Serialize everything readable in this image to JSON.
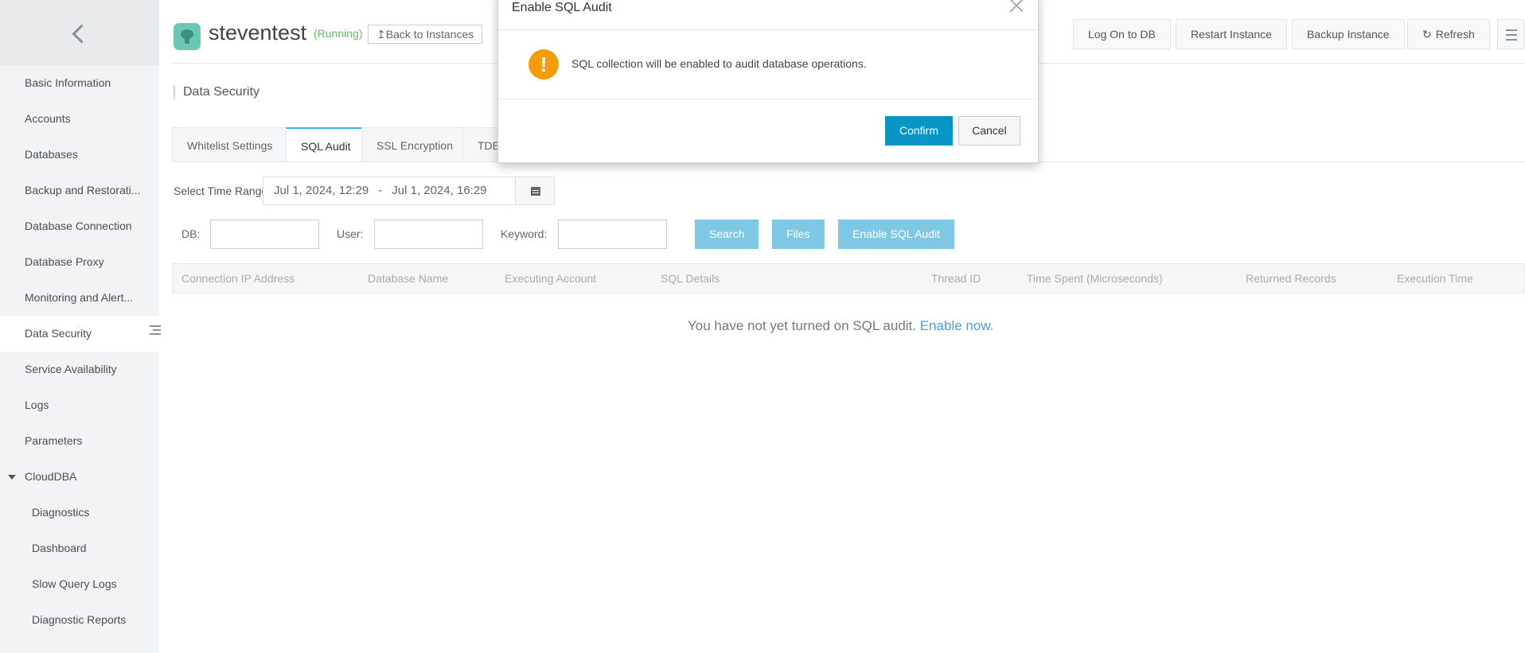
{
  "sidebar": {
    "items": [
      {
        "label": "Basic Information"
      },
      {
        "label": "Accounts"
      },
      {
        "label": "Databases"
      },
      {
        "label": "Backup and Restorati..."
      },
      {
        "label": "Database Connection"
      },
      {
        "label": "Database Proxy"
      },
      {
        "label": "Monitoring and Alert..."
      },
      {
        "label": "Data Security",
        "active": true
      },
      {
        "label": "Service Availability"
      },
      {
        "label": "Logs"
      },
      {
        "label": "Parameters"
      },
      {
        "label": "CloudDBA",
        "expanded": true
      },
      {
        "label": "Diagnostics"
      },
      {
        "label": "Dashboard"
      },
      {
        "label": "Slow Query Logs"
      },
      {
        "label": "Diagnostic Reports"
      }
    ]
  },
  "header": {
    "instance_name": "steventest",
    "status": "(Running)",
    "back_label": "Back to Instances",
    "buttons": {
      "log_on": "Log On to DB",
      "restart": "Restart Instance",
      "backup": "Backup Instance",
      "refresh": "Refresh"
    }
  },
  "section_title": "Data Security",
  "tabs": [
    {
      "label": "Whitelist Settings"
    },
    {
      "label": "SQL Audit",
      "active": true
    },
    {
      "label": "SSL Encryption"
    },
    {
      "label": "TDE"
    }
  ],
  "time_range": {
    "label": "Select Time Range",
    "start": "Jul 1, 2024, 12:29",
    "separator": "-",
    "end": "Jul 1, 2024, 16:29"
  },
  "filters": {
    "db_label": "DB:",
    "db_value": "",
    "user_label": "User:",
    "user_value": "",
    "keyword_label": "Keyword:",
    "keyword_value": "",
    "search_label": "Search",
    "files_label": "Files",
    "enable_label": "Enable SQL Audit"
  },
  "table": {
    "columns": [
      "Connection IP Address",
      "Database Name",
      "Executing Account",
      "SQL Details",
      "Thread ID",
      "Time Spent (Microseconds)",
      "Returned Records",
      "Execution Time"
    ],
    "empty_text": "You have not yet turned on SQL audit.",
    "empty_link": "Enable now."
  },
  "modal": {
    "title": "Enable SQL Audit",
    "message": "SQL collection will be enabled to audit database operations.",
    "confirm_label": "Confirm",
    "cancel_label": "Cancel"
  },
  "colors": {
    "accent": "#0895c8",
    "warning": "#f59b0c",
    "running": "#6ab86a",
    "disabled_button": "#7ec8e3"
  }
}
